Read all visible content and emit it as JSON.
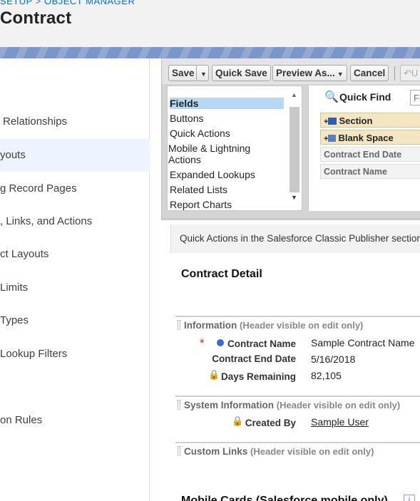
{
  "header": {
    "breadcrumb": [
      "SETUP",
      "OBJECT MANAGER"
    ],
    "breadcrumb_sep": ">",
    "object_title": "Contract"
  },
  "sidebar": {
    "items": [
      {
        "label": "Relationships",
        "selected": false
      },
      {
        "label": "youts",
        "selected": true
      },
      {
        "label": "g Record Pages",
        "selected": false
      },
      {
        "label": ", Links, and Actions",
        "selected": false
      },
      {
        "label": "ct Layouts",
        "selected": false
      },
      {
        "label": "Limits",
        "selected": false
      },
      {
        "label": "Types",
        "selected": false
      },
      {
        "label": "Lookup Filters",
        "selected": false
      },
      {
        "label": "on Rules",
        "selected": false
      }
    ]
  },
  "toolbar": {
    "save_label": "Save",
    "quick_save_label": "Quick Save",
    "preview_label": "Preview As...",
    "cancel_label": "Cancel",
    "undo_label": "U"
  },
  "palette": {
    "categories": [
      {
        "label": "Fields",
        "selected": true
      },
      {
        "label": "Buttons",
        "selected": false
      },
      {
        "label": "Quick Actions",
        "selected": false
      },
      {
        "label": "Mobile & Lightning Actions",
        "selected": false
      },
      {
        "label": "Expanded Lookups",
        "selected": false
      },
      {
        "label": "Related Lists",
        "selected": false
      },
      {
        "label": "Report Charts",
        "selected": false
      }
    ],
    "quick_find_label": "Quick Find",
    "quick_find_placeholder": "Field N",
    "items": [
      {
        "label": "Section",
        "kind": "tan"
      },
      {
        "label": "Blank Space",
        "kind": "tan"
      },
      {
        "label": "Contract End Date",
        "kind": "plain"
      },
      {
        "label": "Contract Name",
        "kind": "plain"
      }
    ]
  },
  "layout": {
    "quick_actions_text": "Quick Actions in the Salesforce Classic Publisher section",
    "detail_title": "Contract Detail",
    "sections": [
      {
        "name": "Information",
        "hint": "(Header visible on edit only)"
      },
      {
        "name": "System Information",
        "hint": "(Header visible on edit only)"
      },
      {
        "name": "Custom Links",
        "hint": "(Header visible on edit only)"
      }
    ],
    "fields": {
      "contract_name_label": "Contract Name",
      "contract_name_value": "Sample Contract Name",
      "end_date_label": "Contract End Date",
      "end_date_value": "5/16/2018",
      "days_remaining_label": "Days Remaining",
      "days_remaining_value": "82,105",
      "created_by_label": "Created By",
      "created_by_value": "Sample User"
    },
    "mobile_cards_title": "Mobile Cards (Salesforce mobile only)"
  },
  "colors": {
    "link": "#0070d2",
    "selected_nav": "#eef4ff",
    "required": "#e0261a"
  }
}
